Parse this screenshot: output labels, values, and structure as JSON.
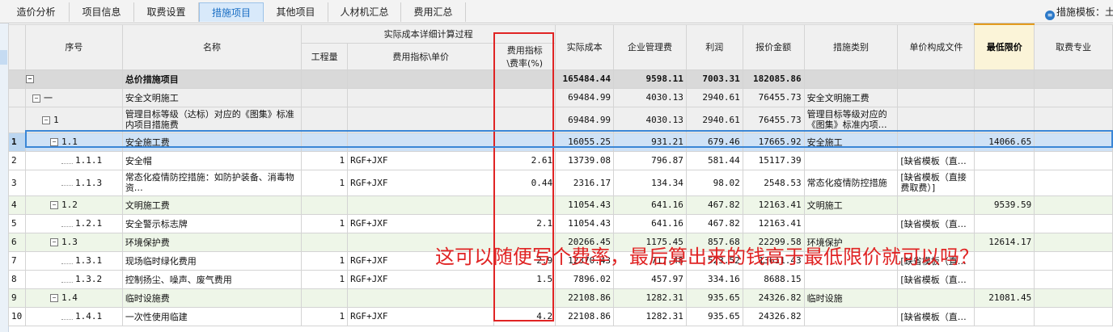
{
  "tabs": [
    "造价分析",
    "项目信息",
    "取费设置",
    "措施项目",
    "其他项目",
    "人材机汇总",
    "费用汇总"
  ],
  "active_tab": 3,
  "template_label": "措施模板：土建",
  "headers": {
    "seq": "序号",
    "name": "名称",
    "group": "实际成本详细计算过程",
    "qty": "工程量",
    "index_unit": "费用指标\\单价",
    "rate_l1": "费用指标",
    "rate_l2": "\\费率(%)",
    "actual": "实际成本",
    "mgmt": "企业管理费",
    "profit": "利润",
    "quote": "报价金额",
    "type": "措施类别",
    "file": "单价构成文件",
    "min": "最低限价",
    "spec": "取费专业"
  },
  "rows": [
    {
      "rn": "",
      "code": "",
      "name": "总价措施项目",
      "qty": "",
      "unit": "",
      "rate": "",
      "actual": "165484.44",
      "mgmt": "9598.11",
      "profit": "7003.31",
      "quote": "182085.86",
      "type": "",
      "file": "",
      "min": "",
      "kind": "lvl0",
      "level": 0,
      "toggle": "−"
    },
    {
      "rn": "",
      "code": "一",
      "name": "安全文明施工",
      "qty": "",
      "unit": "",
      "rate": "",
      "actual": "69484.99",
      "mgmt": "4030.13",
      "profit": "2940.61",
      "quote": "76455.73",
      "type": "安全文明施工费",
      "file": "",
      "min": "",
      "kind": "lvl1",
      "level": 1,
      "toggle": "−"
    },
    {
      "rn": "",
      "code": "1",
      "name": "管理目标等级（达标）对应的《图集》标准内项目措施费",
      "qty": "",
      "unit": "",
      "rate": "",
      "actual": "69484.99",
      "mgmt": "4030.13",
      "profit": "2940.61",
      "quote": "76455.73",
      "type": "管理目标等级对应的《图集》标准内项…",
      "file": "",
      "min": "",
      "kind": "lvl2",
      "level": 2,
      "toggle": "−",
      "tall": true
    },
    {
      "rn": "1",
      "code": "1.1",
      "name": "安全施工费",
      "qty": "",
      "unit": "",
      "rate": "",
      "actual": "16055.25",
      "mgmt": "931.21",
      "profit": "679.46",
      "quote": "17665.92",
      "type": "安全施工",
      "file": "",
      "min": "14066.65",
      "kind": "sel",
      "level": 3,
      "toggle": "−"
    },
    {
      "rn": "2",
      "code": "1.1.1",
      "name": "安全帽",
      "qty": "1",
      "unit": "RGF+JXF",
      "rate": "2.61",
      "actual": "13739.08",
      "mgmt": "796.87",
      "profit": "581.44",
      "quote": "15117.39",
      "type": "",
      "file": "[缺省模板（直…",
      "min": "",
      "kind": "leaf",
      "level": 4,
      "toggle": ""
    },
    {
      "rn": "3",
      "code": "1.1.3",
      "name": "常态化疫情防控措施：如防护装备、消毒物资…",
      "qty": "1",
      "unit": "RGF+JXF",
      "rate": "0.44",
      "actual": "2316.17",
      "mgmt": "134.34",
      "profit": "98.02",
      "quote": "2548.53",
      "type": "常态化疫情防控措施",
      "file": "[缺省模板（直接费取费）]",
      "min": "",
      "kind": "leaf",
      "level": 4,
      "toggle": "",
      "tall": true
    },
    {
      "rn": "4",
      "code": "1.2",
      "name": "文明施工费",
      "qty": "",
      "unit": "",
      "rate": "",
      "actual": "11054.43",
      "mgmt": "641.16",
      "profit": "467.82",
      "quote": "12163.41",
      "type": "文明施工",
      "file": "",
      "min": "9539.59",
      "kind": "lvl3",
      "level": 3,
      "toggle": "−"
    },
    {
      "rn": "5",
      "code": "1.2.1",
      "name": "安全警示标志牌",
      "qty": "1",
      "unit": "RGF+JXF",
      "rate": "2.1",
      "actual": "11054.43",
      "mgmt": "641.16",
      "profit": "467.82",
      "quote": "12163.41",
      "type": "",
      "file": "[缺省模板（直…",
      "min": "",
      "kind": "leaf",
      "level": 4,
      "toggle": ""
    },
    {
      "rn": "6",
      "code": "1.3",
      "name": "环境保护费",
      "qty": "",
      "unit": "",
      "rate": "",
      "actual": "20266.45",
      "mgmt": "1175.45",
      "profit": "857.68",
      "quote": "22299.58",
      "type": "环境保护",
      "file": "",
      "min": "12614.17",
      "kind": "lvl3",
      "level": 3,
      "toggle": "−"
    },
    {
      "rn": "7",
      "code": "1.3.1",
      "name": "现场临时绿化费用",
      "qty": "1",
      "unit": "RGF+JXF",
      "rate": "2.9",
      "actual": "12370.43",
      "mgmt": "717.48",
      "profit": "523.52",
      "quote": "13611.43",
      "type": "",
      "file": "[缺省模板（直…",
      "min": "",
      "kind": "leaf",
      "level": 4,
      "toggle": ""
    },
    {
      "rn": "8",
      "code": "1.3.2",
      "name": "控制扬尘、噪声、废气费用",
      "qty": "1",
      "unit": "RGF+JXF",
      "rate": "1.5",
      "actual": "7896.02",
      "mgmt": "457.97",
      "profit": "334.16",
      "quote": "8688.15",
      "type": "",
      "file": "[缺省模板（直…",
      "min": "",
      "kind": "leaf",
      "level": 4,
      "toggle": ""
    },
    {
      "rn": "9",
      "code": "1.4",
      "name": "临时设施费",
      "qty": "",
      "unit": "",
      "rate": "",
      "actual": "22108.86",
      "mgmt": "1282.31",
      "profit": "935.65",
      "quote": "24326.82",
      "type": "临时设施",
      "file": "",
      "min": "21081.45",
      "kind": "lvl3",
      "level": 3,
      "toggle": "−"
    },
    {
      "rn": "10",
      "code": "1.4.1",
      "name": "一次性使用临建",
      "qty": "1",
      "unit": "RGF+JXF",
      "rate": "4.2",
      "actual": "22108.86",
      "mgmt": "1282.31",
      "profit": "935.65",
      "quote": "24326.82",
      "type": "",
      "file": "[缺省模板（直…",
      "min": "",
      "kind": "leaf",
      "level": 4,
      "toggle": ""
    }
  ],
  "annotation": "这可以随便写个费率，最后算出来的钱高于最低限价就可以吗？",
  "colors": {
    "highlight_border": "#e02424",
    "selected_row": "#cfe2f6",
    "header_accent": "#e39b1d"
  }
}
